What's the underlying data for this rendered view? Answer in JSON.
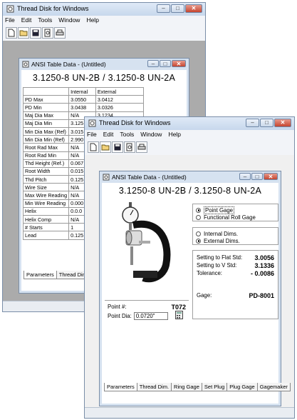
{
  "app": {
    "title": "Thread Disk for Windows",
    "menu": [
      "File",
      "Edit",
      "Tools",
      "Window",
      "Help"
    ],
    "toolbar_icons": [
      "new-document-icon",
      "open-folder-icon",
      "save-disk-icon",
      "print-preview-icon",
      "print-icon"
    ]
  },
  "back_child": {
    "title": "ANSI Table Data - (Untitled)",
    "header": "3.1250-8 UN-2B  /  3.1250-8 UN-2A",
    "columns": [
      "",
      "Internal",
      "External"
    ],
    "rows": [
      [
        "PD Max",
        "3.0550",
        "3.0412"
      ],
      [
        "PD Min",
        "3.0438",
        "3.0326"
      ],
      [
        "Maj Dia Max",
        "N/A",
        "3.1234"
      ],
      [
        "Maj Dia Min",
        "3.125",
        ""
      ],
      [
        "Min Dia Max (Ref)",
        "3.015",
        ""
      ],
      [
        "Min Dia Min (Ref)",
        "2.990",
        ""
      ],
      [
        "Root Rad Max",
        "N/A",
        ""
      ],
      [
        "Root Rad Min",
        "N/A",
        ""
      ],
      [
        "Thd Height (Ref.)",
        "0.067",
        ""
      ],
      [
        "Root Width",
        "0.015",
        ""
      ],
      [
        "Thd Pitch",
        "0.125",
        ""
      ],
      [
        "Wire Size",
        "N/A",
        ""
      ],
      [
        "Max Wire Reading",
        "N/A",
        ""
      ],
      [
        "Min Wire Reading",
        "0.000",
        ""
      ],
      [
        "Helix",
        "0.0.0",
        ""
      ],
      [
        "Helix Comp",
        "N/A",
        ""
      ],
      [
        "# Starts",
        "1",
        ""
      ],
      [
        "Lead",
        "0.125",
        ""
      ]
    ],
    "tabs": [
      "Parameters",
      "Thread Dim"
    ]
  },
  "front_child": {
    "title": "ANSI Table Data - (Untitled)",
    "header": "3.1250-8 UN-2B  /  3.1250-8 UN-2A",
    "gage_type": {
      "options": [
        "Point Gage",
        "Functional Roll Gage"
      ],
      "selected": 0
    },
    "dims": {
      "options": [
        "Internal Dims.",
        "External Dims."
      ],
      "selected": 1
    },
    "settings": [
      {
        "label": "Setting to Flat Std:",
        "value": "3.0056"
      },
      {
        "label": "Setting to V Std:",
        "value": "3.1336"
      },
      {
        "label": "Tolerance:",
        "value": "- 0.0086"
      }
    ],
    "gage": {
      "label": "Gage:",
      "value": "PD-8001"
    },
    "point": {
      "label": "Point #:",
      "value": "T072"
    },
    "point_dia": {
      "label": "Point Dia:",
      "value": "0.0720\""
    },
    "tabs": [
      "Parameters",
      "Thread Dim.",
      "Ring Gage",
      "Set Plug",
      "Plug Gage",
      "Gagemaker"
    ]
  }
}
